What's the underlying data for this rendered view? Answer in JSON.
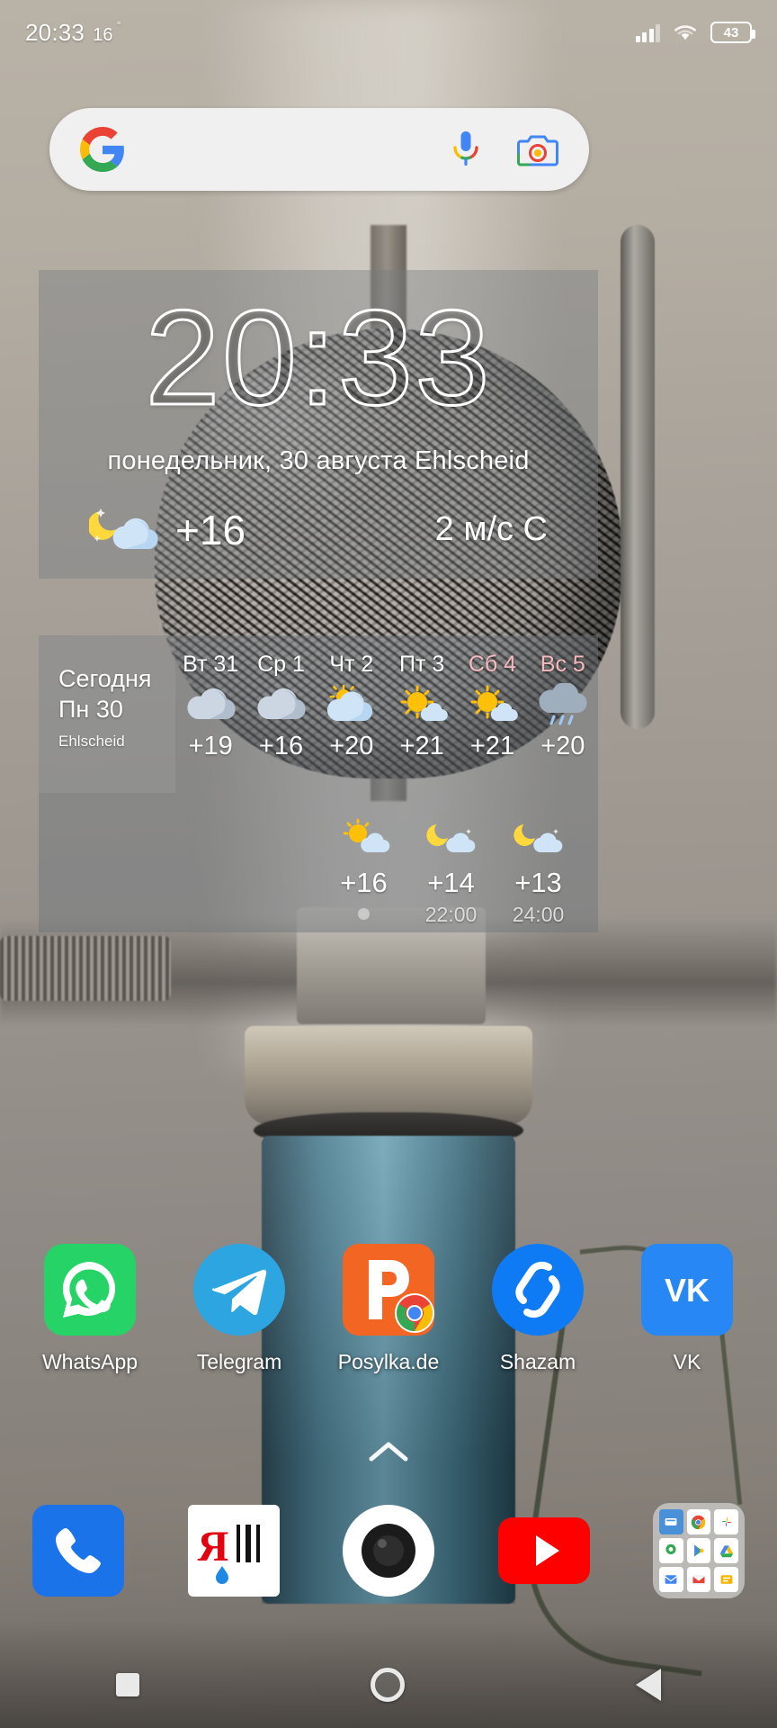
{
  "statusbar": {
    "time": "20:33",
    "temp": "16",
    "degree": "°",
    "battery": "43",
    "signal_icon": "cellular-signal-icon",
    "wifi_icon": "wifi-icon",
    "battery_icon": "battery-icon"
  },
  "search": {
    "placeholder": "",
    "value": "",
    "google_icon": "google-g-logo",
    "mic_icon": "microphone-icon",
    "lens_icon": "google-lens-camera-icon"
  },
  "clock_widget": {
    "time": "20:33",
    "date": "понедельник, 30 августа Ehlscheid",
    "condition_icon": "moon-cloud-night-icon",
    "temperature": "+16",
    "wind": "2 м/с С"
  },
  "forecast_widget": {
    "today_label": "Сегодня",
    "today_day": "Пн 30",
    "location": "Ehlscheid",
    "days": [
      {
        "label": "Вт 31",
        "temp": "+19",
        "icon": "cloud-icon",
        "weekend": false
      },
      {
        "label": "Ср 1",
        "temp": "+16",
        "icon": "cloud-icon",
        "weekend": false
      },
      {
        "label": "Чт 2",
        "temp": "+20",
        "icon": "sun-behind-cloud-icon",
        "weekend": false
      },
      {
        "label": "Пт 3",
        "temp": "+21",
        "icon": "sun-small-cloud-icon",
        "weekend": false
      },
      {
        "label": "Сб 4",
        "temp": "+21",
        "icon": "sun-small-cloud-icon",
        "weekend": true
      },
      {
        "label": "Вс 5",
        "temp": "+20",
        "icon": "rain-cloud-icon",
        "weekend": true
      }
    ],
    "hours": [
      {
        "icon": "sun-small-cloud-icon",
        "temp": "+16",
        "time": "",
        "dot": true
      },
      {
        "icon": "moon-cloud-night-icon",
        "temp": "+14",
        "time": "22:00",
        "dot": false
      },
      {
        "icon": "moon-cloud-night-icon",
        "temp": "+13",
        "time": "24:00",
        "dot": false
      }
    ]
  },
  "apps": [
    {
      "label": "WhatsApp",
      "icon": "whatsapp-icon"
    },
    {
      "label": "Telegram",
      "icon": "telegram-icon"
    },
    {
      "label": "Posylka.de",
      "icon": "posylka-de-icon"
    },
    {
      "label": "Shazam",
      "icon": "shazam-icon"
    },
    {
      "label": "VK",
      "icon": "vk-icon"
    }
  ],
  "page_indicator": {
    "icon": "chevron-up-icon"
  },
  "dock": [
    {
      "icon": "phone-dialer-icon"
    },
    {
      "icon": "yandex-browser-icon"
    },
    {
      "icon": "camera-icon"
    },
    {
      "icon": "youtube-icon"
    },
    {
      "icon": "app-folder-icon"
    }
  ],
  "navbar": {
    "recents_icon": "recents-square-icon",
    "home_icon": "home-circle-icon",
    "back_icon": "back-triangle-icon"
  },
  "colors": {
    "whatsapp_green": "#25D366",
    "telegram_blue": "#2CA5E0",
    "posylka_orange": "#F26522",
    "shazam_blue": "#0E7BF5",
    "vk_blue": "#2787F5",
    "youtube_red": "#FF0000",
    "phone_blue": "#1A73E8",
    "weekend_pink": "#F6B9BD",
    "widget_overlay": "rgba(110,116,122,0.46)"
  }
}
